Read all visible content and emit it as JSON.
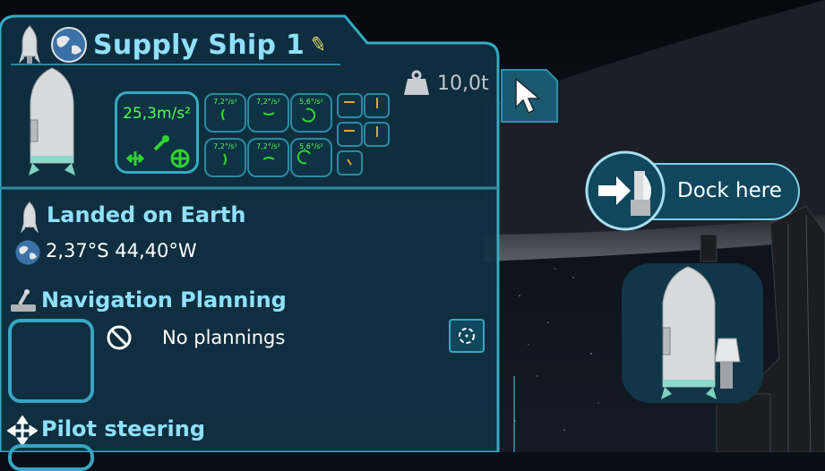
{
  "vessel": {
    "name": "Supply Ship 1",
    "mass": "10,0t"
  },
  "acceleration": {
    "main": "25,3m/s²",
    "rotation": [
      "7,2°/s²",
      "7,2°/s²",
      "5,6°/s²",
      "7,2°/s²",
      "7,2°/s²",
      "5,6°/s²"
    ]
  },
  "status": {
    "landed": "Landed on Earth",
    "coords": "2,37°S 44,40°W"
  },
  "navigation": {
    "title": "Navigation Planning",
    "empty": "No plannings"
  },
  "pilot": {
    "title": "Pilot steering"
  },
  "dock": {
    "label": "Dock here"
  },
  "colors": {
    "accent": "#8fe0ff",
    "panel": "#0f3142",
    "border": "#35a9c3",
    "accel_text": "#53ff53"
  },
  "icons": [
    "rocket-icon",
    "earth-icon",
    "pencil-icon",
    "weight-icon",
    "cursor-icon",
    "joystick-icon",
    "no-entry-icon",
    "target-icon",
    "steering-icon",
    "dock-icon"
  ]
}
